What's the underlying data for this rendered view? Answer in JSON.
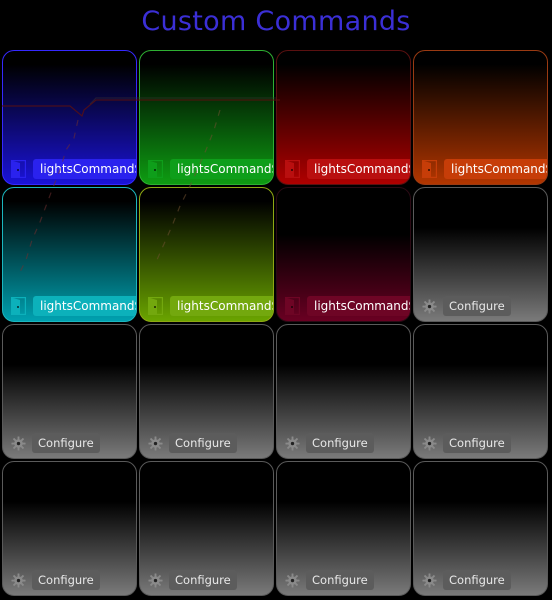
{
  "page": {
    "title": "Custom Commands"
  },
  "tiles": [
    {
      "kind": "command",
      "label": "lightsCommandSingle",
      "color": "#1a13d9",
      "border": "#3528ff",
      "label_bg": "#2a22ee",
      "icon": "door-icon"
    },
    {
      "kind": "command",
      "label": "lightsCommandSingle",
      "color": "#0e9d12",
      "border": "#2eb032",
      "label_bg": "#0e9e1a",
      "icon": "door-icon"
    },
    {
      "kind": "command",
      "label": "lightsCommandSingle",
      "color": "#b00000",
      "border": "#5a1010",
      "label_bg": "#b90f0f",
      "icon": "door-icon"
    },
    {
      "kind": "command",
      "label": "lightsCommandSingle",
      "color": "#b33600",
      "border": "#9a3a12",
      "label_bg": "#c63d08",
      "icon": "door-icon"
    },
    {
      "kind": "command",
      "label": "lightsCommandSingle",
      "color": "#00a1b0",
      "border": "#1bb7bf",
      "label_bg": "#0cb1bb",
      "icon": "door-icon"
    },
    {
      "kind": "command",
      "label": "lightsCommandSingle",
      "color": "#6aa400",
      "border": "#8ea812",
      "label_bg": "#73a80e",
      "icon": "door-icon"
    },
    {
      "kind": "command",
      "label": "lightsCommandSingle",
      "color": "#6a0022",
      "border": "#2a0a14",
      "label_bg": "#6e0525",
      "icon": "door-icon",
      "dim": true
    },
    {
      "kind": "empty",
      "label": "Configure",
      "icon": "gear-icon"
    },
    {
      "kind": "empty",
      "label": "Configure",
      "icon": "gear-icon"
    },
    {
      "kind": "empty",
      "label": "Configure",
      "icon": "gear-icon"
    },
    {
      "kind": "empty",
      "label": "Configure",
      "icon": "gear-icon"
    },
    {
      "kind": "empty",
      "label": "Configure",
      "icon": "gear-icon"
    },
    {
      "kind": "empty",
      "label": "Configure",
      "icon": "gear-icon"
    },
    {
      "kind": "empty",
      "label": "Configure",
      "icon": "gear-icon"
    },
    {
      "kind": "empty",
      "label": "Configure",
      "icon": "gear-icon"
    },
    {
      "kind": "empty",
      "label": "Configure",
      "icon": "gear-icon"
    }
  ]
}
